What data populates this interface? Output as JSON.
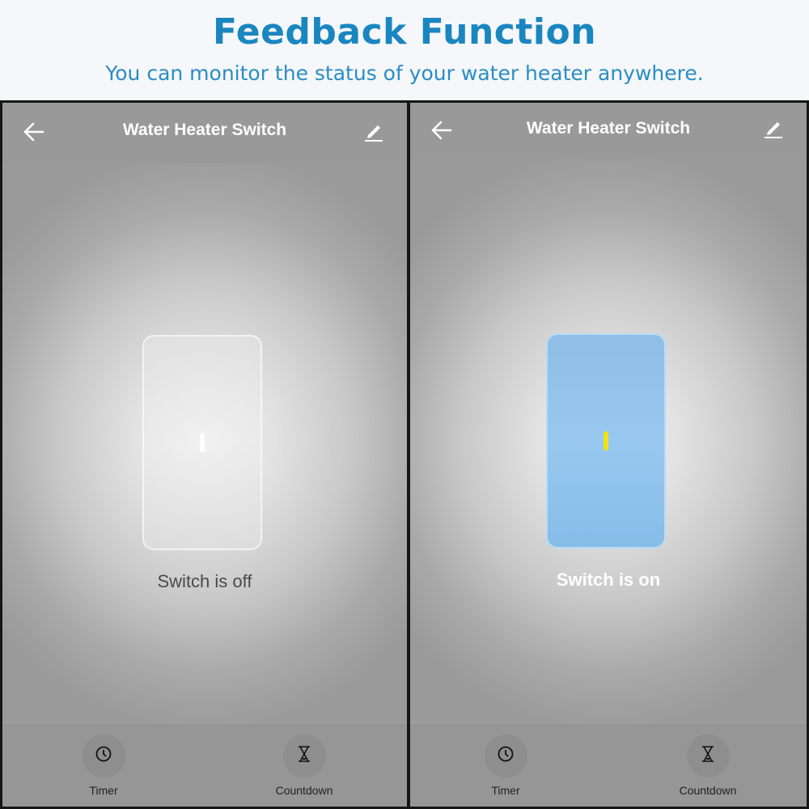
{
  "header": {
    "title": "Feedback Function",
    "subtitle": "You can monitor the status of your water heater anywhere."
  },
  "colors": {
    "header_title": "#1a86c0",
    "switch_on_fill": "#98c8ef",
    "switch_on_indicator": "#f2e01b",
    "topbar": "#999999"
  },
  "screens": [
    {
      "title": "Water Heater Switch",
      "back_icon": "arrow-left-icon",
      "edit_icon": "pencil-icon",
      "switch_state": "off",
      "status": "Switch is off",
      "actions": [
        {
          "label": "Timer",
          "icon": "clock-icon"
        },
        {
          "label": "Countdown",
          "icon": "hourglass-icon"
        }
      ]
    },
    {
      "title": "Water Heater Switch",
      "back_icon": "arrow-left-icon",
      "edit_icon": "pencil-icon",
      "switch_state": "on",
      "status": "Switch is on",
      "actions": [
        {
          "label": "Timer",
          "icon": "clock-icon"
        },
        {
          "label": "Countdown",
          "icon": "hourglass-icon"
        }
      ]
    }
  ]
}
